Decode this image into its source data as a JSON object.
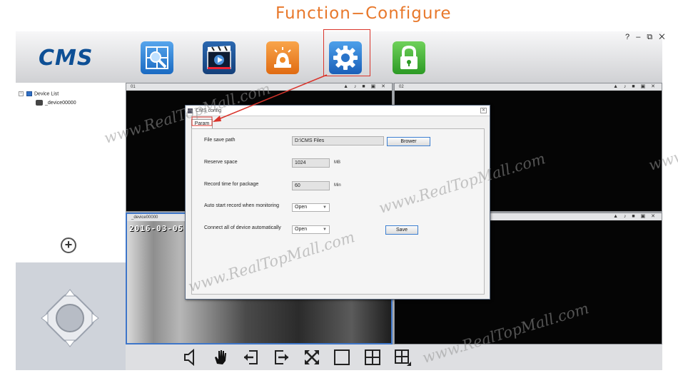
{
  "headline": "Function−Configure",
  "app": {
    "logo": "CMS",
    "toolbar": [
      {
        "name": "search-device",
        "icon": "search-icon"
      },
      {
        "name": "playback",
        "icon": "video-icon"
      },
      {
        "name": "alarm",
        "icon": "alarm-icon"
      },
      {
        "name": "config",
        "icon": "gear-icon"
      },
      {
        "name": "lock",
        "icon": "lock-icon"
      }
    ],
    "window_controls": {
      "help": "?",
      "minimize": "–",
      "restore": "⧉",
      "close": "✕"
    },
    "tree": {
      "root": "Device List",
      "child": "_device00000",
      "expander": "−"
    },
    "add_symbol": "+"
  },
  "panes": {
    "p1": {
      "label": "01"
    },
    "p2": {
      "label": "02"
    },
    "p3": {
      "label": "_device00000",
      "timestamp": "2016-03-05"
    },
    "icons": "▲ ♪ ■ ▣ ✕"
  },
  "dialog": {
    "title": "CMS config",
    "close": "✕",
    "tab": "Param",
    "rows": {
      "save_path": {
        "label": "File save path",
        "value": "D:\\CMS Files",
        "button": "Brower"
      },
      "reserve": {
        "label": "Reserve space",
        "value": "1024",
        "unit": "MB"
      },
      "record_time": {
        "label": "Record time for package",
        "value": "60",
        "unit": "Min"
      },
      "auto_record": {
        "label": "Auto start record when monitoring",
        "value": "Open"
      },
      "auto_connect": {
        "label": "Connect all of device automatically",
        "value": "Open",
        "button": "Save"
      }
    }
  },
  "watermark": "www.RealTopMall.com",
  "colors": {
    "headline": "#e8782b",
    "highlight": "#d9342b",
    "logo": "#0d4f95",
    "button_border": "#3c7fd1"
  }
}
